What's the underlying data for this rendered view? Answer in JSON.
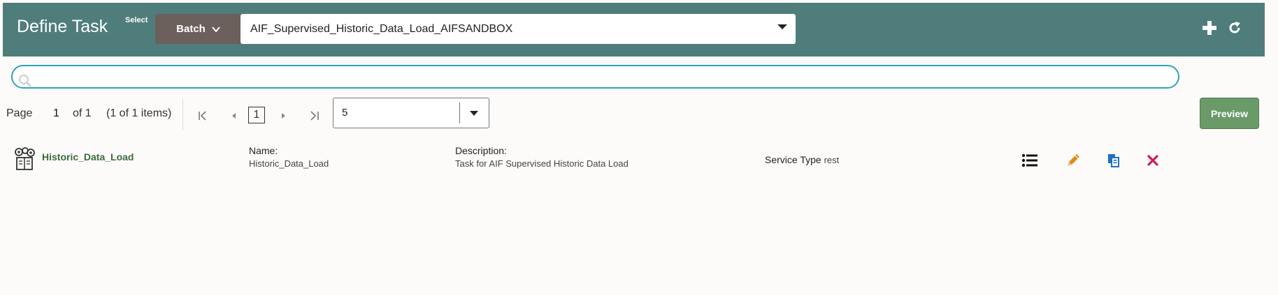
{
  "header": {
    "title": "Define Task",
    "select_label": "Select",
    "batch_button": "Batch",
    "batch_value": "AIF_Supervised_Historic_Data_Load_AIFSANDBOX",
    "icons": [
      "plus-icon",
      "refresh-icon"
    ]
  },
  "search": {
    "placeholder": "",
    "value": ""
  },
  "pagination": {
    "page_label": "Page",
    "page_number": "1",
    "of_pages": "of 1",
    "items_summary": "(1 of 1 items)",
    "current_page": "1",
    "page_size": "5"
  },
  "preview_button": "Preview",
  "row": {
    "task_name": "Historic_Data_Load",
    "name_label": "Name:",
    "name_value": "Historic_Data_Load",
    "description_label": "Description:",
    "description_value": "Task for AIF Supervised Historic Data Load",
    "service_type_label": "Service Type",
    "service_type_value": "rest",
    "actions": [
      "list-icon",
      "edit-pencil-icon",
      "copy-icon",
      "delete-x-icon"
    ]
  },
  "colors": {
    "header_bg": "#4f7d7b",
    "batch_button_bg": "#6b605b",
    "search_border": "#2ba6b3",
    "preview_bg": "#6b9a69",
    "link_green": "#3a6b3d",
    "edit_orange": "#e08a1e",
    "copy_blue": "#1f6fc5",
    "delete_red": "#d01c53"
  }
}
